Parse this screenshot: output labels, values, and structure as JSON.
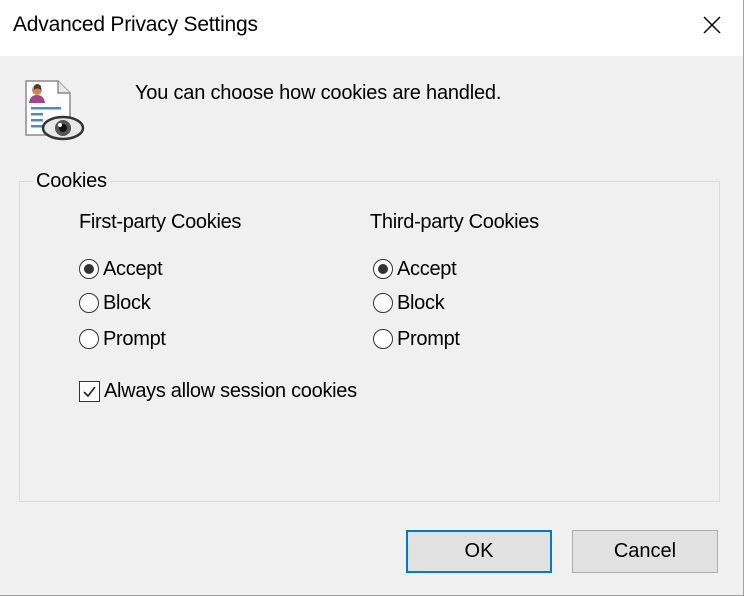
{
  "window": {
    "title": "Advanced Privacy Settings",
    "close_glyph": "×"
  },
  "header": {
    "icon": "privacy-document-eye-icon",
    "description": "You can choose how cookies are handled."
  },
  "cookies_group": {
    "legend": "Cookies",
    "first_party": {
      "heading": "First-party Cookies",
      "options": [
        {
          "label": "Accept",
          "selected": true
        },
        {
          "label": "Block",
          "selected": false
        },
        {
          "label": "Prompt",
          "selected": false
        }
      ]
    },
    "third_party": {
      "heading": "Third-party Cookies",
      "options": [
        {
          "label": "Accept",
          "selected": true
        },
        {
          "label": "Block",
          "selected": false
        },
        {
          "label": "Prompt",
          "selected": false
        }
      ]
    },
    "session_checkbox": {
      "label": "Always allow session cookies",
      "checked": true
    }
  },
  "buttons": {
    "ok_label": "OK",
    "cancel_label": "Cancel"
  },
  "colors": {
    "dialog_bg": "#f0f0f0",
    "titlebar_bg": "#ffffff",
    "default_button_border": "#0078d7"
  }
}
